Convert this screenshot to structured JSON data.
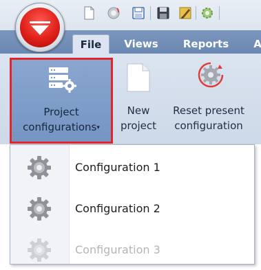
{
  "ribbon_tabs": [
    {
      "label": "File",
      "active": true
    },
    {
      "label": "Views",
      "active": false
    },
    {
      "label": "Reports",
      "active": false
    },
    {
      "label": "A",
      "active": false
    }
  ],
  "ribbon_buttons": {
    "project_configurations": {
      "line1": "Project",
      "line2": "configurations",
      "caret": "▾"
    },
    "new_project": {
      "line1": "New",
      "line2": "project"
    },
    "reset_configuration": {
      "line1": "Reset present",
      "line2": "configuration"
    }
  },
  "dropdown": {
    "items": [
      {
        "label": "Configuration 1",
        "enabled": true
      },
      {
        "label": "Configuration 2",
        "enabled": true
      },
      {
        "label": "Configuration 3",
        "enabled": false
      }
    ]
  },
  "colors": {
    "accent_red": "#e2252b",
    "tab_bar": "#6b88b2",
    "ribbon_bg": "#dbe4f0"
  },
  "icons": [
    "app-menu-icon",
    "new-document-icon",
    "save-icon",
    "save-all-icon",
    "edit-icon",
    "refresh-icon",
    "server-settings-icon",
    "reset-gear-icon",
    "gear-icon"
  ]
}
